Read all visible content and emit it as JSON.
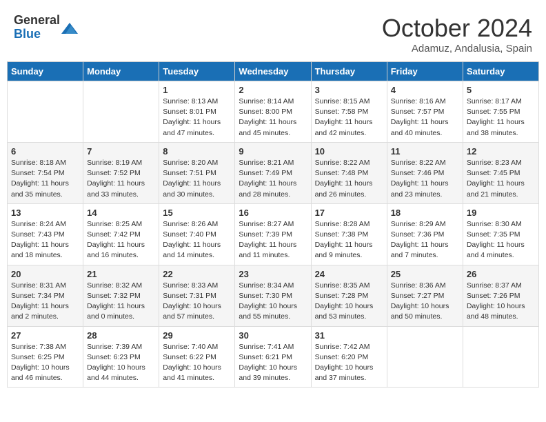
{
  "header": {
    "logo_general": "General",
    "logo_blue": "Blue",
    "month_title": "October 2024",
    "subtitle": "Adamuz, Andalusia, Spain"
  },
  "calendar": {
    "days_of_week": [
      "Sunday",
      "Monday",
      "Tuesday",
      "Wednesday",
      "Thursday",
      "Friday",
      "Saturday"
    ],
    "weeks": [
      [
        {
          "day": "",
          "info": ""
        },
        {
          "day": "",
          "info": ""
        },
        {
          "day": "1",
          "info": "Sunrise: 8:13 AM\nSunset: 8:01 PM\nDaylight: 11 hours and 47 minutes."
        },
        {
          "day": "2",
          "info": "Sunrise: 8:14 AM\nSunset: 8:00 PM\nDaylight: 11 hours and 45 minutes."
        },
        {
          "day": "3",
          "info": "Sunrise: 8:15 AM\nSunset: 7:58 PM\nDaylight: 11 hours and 42 minutes."
        },
        {
          "day": "4",
          "info": "Sunrise: 8:16 AM\nSunset: 7:57 PM\nDaylight: 11 hours and 40 minutes."
        },
        {
          "day": "5",
          "info": "Sunrise: 8:17 AM\nSunset: 7:55 PM\nDaylight: 11 hours and 38 minutes."
        }
      ],
      [
        {
          "day": "6",
          "info": "Sunrise: 8:18 AM\nSunset: 7:54 PM\nDaylight: 11 hours and 35 minutes."
        },
        {
          "day": "7",
          "info": "Sunrise: 8:19 AM\nSunset: 7:52 PM\nDaylight: 11 hours and 33 minutes."
        },
        {
          "day": "8",
          "info": "Sunrise: 8:20 AM\nSunset: 7:51 PM\nDaylight: 11 hours and 30 minutes."
        },
        {
          "day": "9",
          "info": "Sunrise: 8:21 AM\nSunset: 7:49 PM\nDaylight: 11 hours and 28 minutes."
        },
        {
          "day": "10",
          "info": "Sunrise: 8:22 AM\nSunset: 7:48 PM\nDaylight: 11 hours and 26 minutes."
        },
        {
          "day": "11",
          "info": "Sunrise: 8:22 AM\nSunset: 7:46 PM\nDaylight: 11 hours and 23 minutes."
        },
        {
          "day": "12",
          "info": "Sunrise: 8:23 AM\nSunset: 7:45 PM\nDaylight: 11 hours and 21 minutes."
        }
      ],
      [
        {
          "day": "13",
          "info": "Sunrise: 8:24 AM\nSunset: 7:43 PM\nDaylight: 11 hours and 18 minutes."
        },
        {
          "day": "14",
          "info": "Sunrise: 8:25 AM\nSunset: 7:42 PM\nDaylight: 11 hours and 16 minutes."
        },
        {
          "day": "15",
          "info": "Sunrise: 8:26 AM\nSunset: 7:40 PM\nDaylight: 11 hours and 14 minutes."
        },
        {
          "day": "16",
          "info": "Sunrise: 8:27 AM\nSunset: 7:39 PM\nDaylight: 11 hours and 11 minutes."
        },
        {
          "day": "17",
          "info": "Sunrise: 8:28 AM\nSunset: 7:38 PM\nDaylight: 11 hours and 9 minutes."
        },
        {
          "day": "18",
          "info": "Sunrise: 8:29 AM\nSunset: 7:36 PM\nDaylight: 11 hours and 7 minutes."
        },
        {
          "day": "19",
          "info": "Sunrise: 8:30 AM\nSunset: 7:35 PM\nDaylight: 11 hours and 4 minutes."
        }
      ],
      [
        {
          "day": "20",
          "info": "Sunrise: 8:31 AM\nSunset: 7:34 PM\nDaylight: 11 hours and 2 minutes."
        },
        {
          "day": "21",
          "info": "Sunrise: 8:32 AM\nSunset: 7:32 PM\nDaylight: 11 hours and 0 minutes."
        },
        {
          "day": "22",
          "info": "Sunrise: 8:33 AM\nSunset: 7:31 PM\nDaylight: 10 hours and 57 minutes."
        },
        {
          "day": "23",
          "info": "Sunrise: 8:34 AM\nSunset: 7:30 PM\nDaylight: 10 hours and 55 minutes."
        },
        {
          "day": "24",
          "info": "Sunrise: 8:35 AM\nSunset: 7:28 PM\nDaylight: 10 hours and 53 minutes."
        },
        {
          "day": "25",
          "info": "Sunrise: 8:36 AM\nSunset: 7:27 PM\nDaylight: 10 hours and 50 minutes."
        },
        {
          "day": "26",
          "info": "Sunrise: 8:37 AM\nSunset: 7:26 PM\nDaylight: 10 hours and 48 minutes."
        }
      ],
      [
        {
          "day": "27",
          "info": "Sunrise: 7:38 AM\nSunset: 6:25 PM\nDaylight: 10 hours and 46 minutes."
        },
        {
          "day": "28",
          "info": "Sunrise: 7:39 AM\nSunset: 6:23 PM\nDaylight: 10 hours and 44 minutes."
        },
        {
          "day": "29",
          "info": "Sunrise: 7:40 AM\nSunset: 6:22 PM\nDaylight: 10 hours and 41 minutes."
        },
        {
          "day": "30",
          "info": "Sunrise: 7:41 AM\nSunset: 6:21 PM\nDaylight: 10 hours and 39 minutes."
        },
        {
          "day": "31",
          "info": "Sunrise: 7:42 AM\nSunset: 6:20 PM\nDaylight: 10 hours and 37 minutes."
        },
        {
          "day": "",
          "info": ""
        },
        {
          "day": "",
          "info": ""
        }
      ]
    ]
  }
}
